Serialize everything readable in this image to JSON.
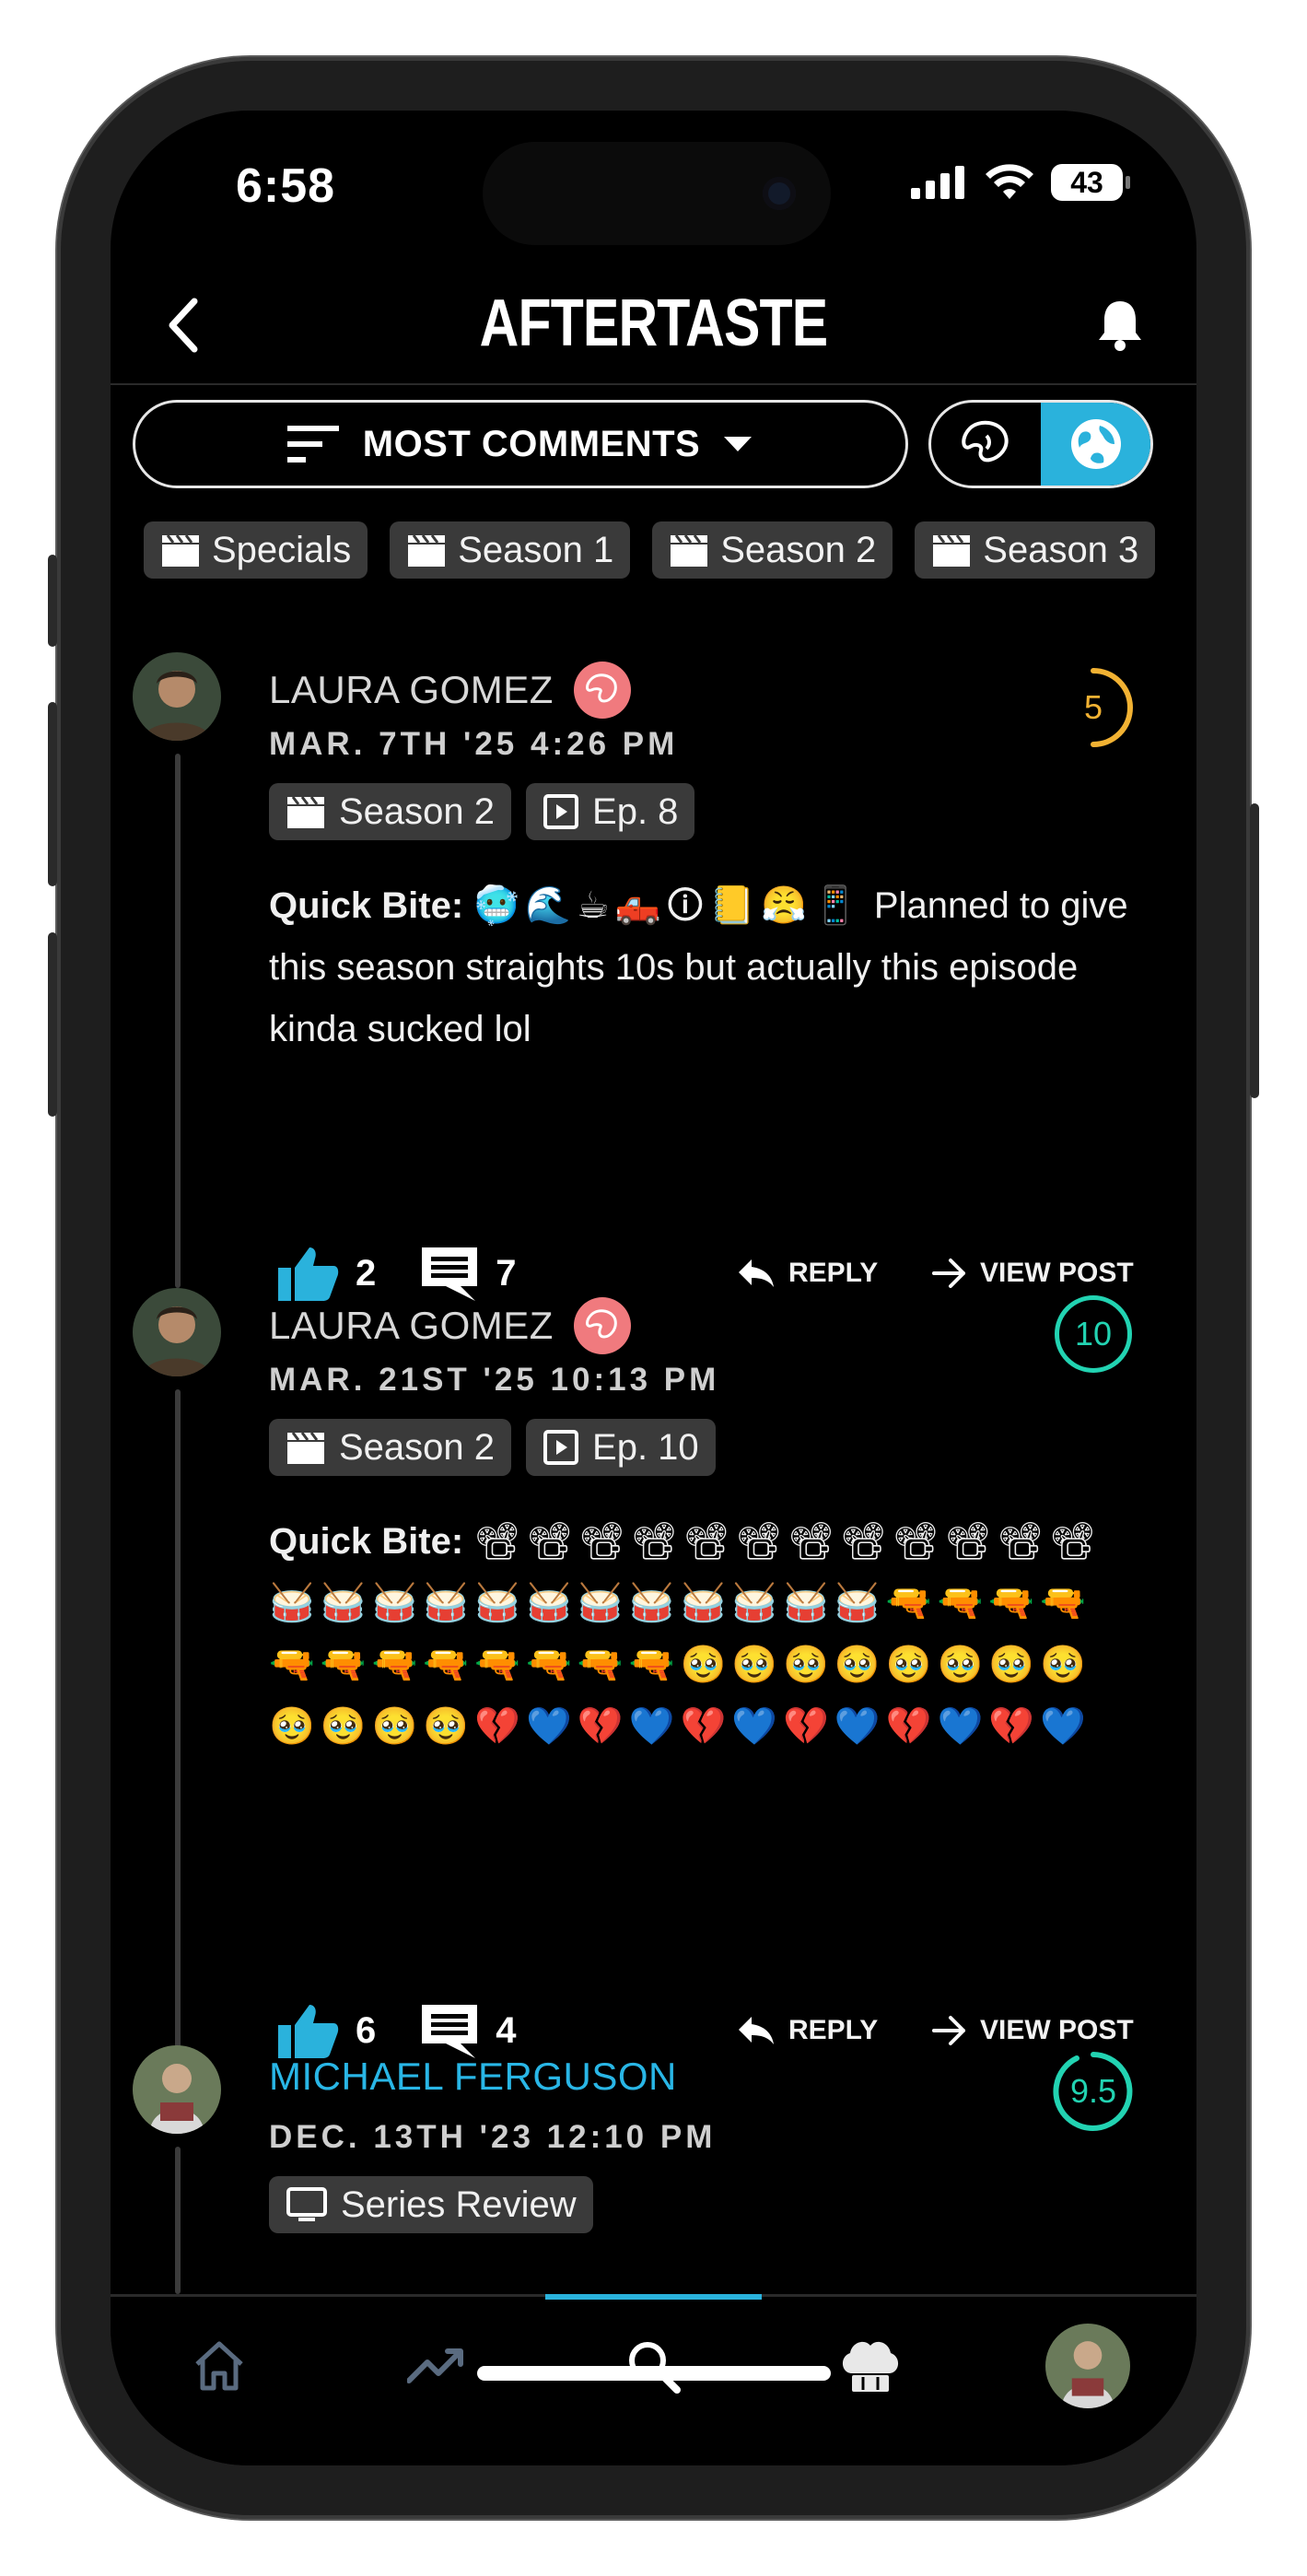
{
  "status": {
    "time": "6:58",
    "battery": "43"
  },
  "header": {
    "title": "AFTERTASTE"
  },
  "sort": {
    "label": "MOST COMMENTS"
  },
  "filters": [
    {
      "label": "Specials"
    },
    {
      "label": "Season 1"
    },
    {
      "label": "Season 2"
    },
    {
      "label": "Season 3"
    }
  ],
  "posts": [
    {
      "author": "LAURA GOMEZ",
      "date": "MAR. 7TH '25 4:26 PM",
      "tags": [
        "Season 2",
        "Ep. 8"
      ],
      "prefix": "Quick Bite:",
      "emojis": "🥶🌊☕🛻🛈📒😤📱",
      "text": "Planned to give this season straights 10s but actually this episode kinda sucked lol",
      "score": "5",
      "score_color": "#f2b233",
      "likes": "2",
      "comments": "7",
      "reply": "REPLY",
      "view": "VIEW POST"
    },
    {
      "author": "LAURA GOMEZ",
      "date": "MAR. 21ST '25 10:13 PM",
      "tags": [
        "Season 2",
        "Ep. 10"
      ],
      "prefix": "Quick Bite:",
      "emojis": "📽📽📽📽📽📽📽📽📽📽📽📽🥁🥁🥁🥁🥁🥁🥁🥁🥁🥁🥁🥁🔫🔫🔫🔫🔫🔫🔫🔫🔫🔫🔫🔫🥹🥹🥹🥹🥹🥹🥹🥹🥹🥹🥹🥹💔💙💔💙💔💙💔💙💔💙💔💙",
      "text": "",
      "score": "10",
      "score_color": "#22d3b2",
      "likes": "6",
      "comments": "4",
      "reply": "REPLY",
      "view": "VIEW POST"
    },
    {
      "author": "MICHAEL FERGUSON",
      "date": "DEC. 13TH '23 12:10 PM",
      "tags": [
        "Series Review"
      ],
      "score": "9.5",
      "score_color": "#22d3b2"
    }
  ],
  "colors": {
    "accent": "#2ab2dc",
    "background": "#000000",
    "chip": "#3a3a3a"
  }
}
